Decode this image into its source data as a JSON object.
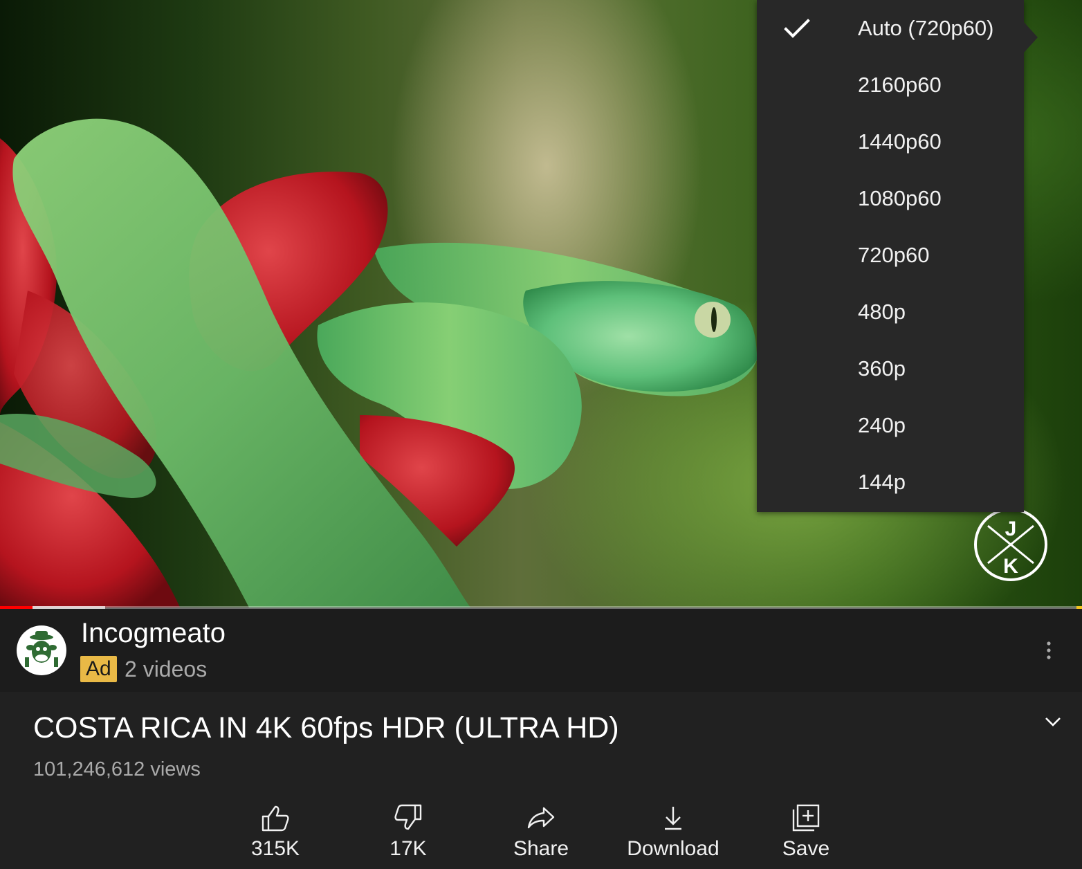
{
  "video": {
    "progress": {
      "played_fraction": 0.03,
      "buffered_fraction": 0.097
    }
  },
  "quality_menu": {
    "selected_index": 0,
    "items": [
      {
        "label": "Auto (720p60)"
      },
      {
        "label": "2160p60"
      },
      {
        "label": "1440p60"
      },
      {
        "label": "1080p60"
      },
      {
        "label": "720p60"
      },
      {
        "label": "480p"
      },
      {
        "label": "360p"
      },
      {
        "label": "240p"
      },
      {
        "label": "144p"
      }
    ]
  },
  "ad": {
    "channel_name": "Incogmeato",
    "badge": "Ad",
    "video_count": "2 videos"
  },
  "title": {
    "text": "COSTA RICA IN 4K 60fps HDR (ULTRA HD)",
    "views": "101,246,612 views"
  },
  "actions": {
    "like": "315K",
    "dislike": "17K",
    "share": "Share",
    "download": "Download",
    "save": "Save"
  },
  "colors": {
    "background": "#212121",
    "menu": "#282828",
    "ad_badge": "#e9b946",
    "progress_played": "#ff0000"
  }
}
